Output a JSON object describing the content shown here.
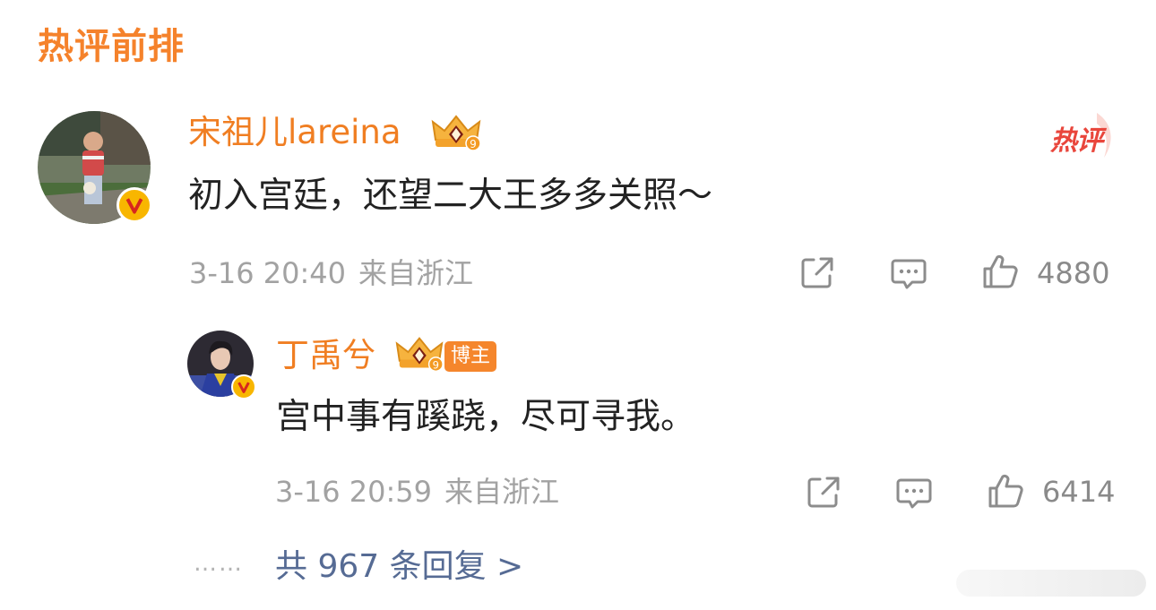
{
  "section": {
    "title": "热评前排"
  },
  "comments": [
    {
      "username": "宋祖儿lareina",
      "crown_level": "9",
      "text": "初入宫廷，还望二大王多多关照～",
      "time": "3-16 20:40",
      "source": "来自浙江",
      "likes": "4880",
      "hot_tag": "热评"
    },
    {
      "username": "丁禹兮",
      "crown_level": "9",
      "badge": "博主",
      "text": "宫中事有蹊跷，尽可寻我。",
      "time": "3-16 20:59",
      "source": "来自浙江",
      "likes": "6414"
    }
  ],
  "footer": {
    "dots": "……",
    "more_replies": "共 967 条回复 >"
  },
  "icons": {
    "share": "share-icon",
    "comment": "comment-icon",
    "like": "like-icon",
    "verified": "verified-v-icon",
    "crown": "crown-icon"
  },
  "colors": {
    "accent": "#f07e22",
    "hot": "#e9463c",
    "link": "#566b94",
    "meta": "#a2a2a2",
    "text": "#222222"
  }
}
